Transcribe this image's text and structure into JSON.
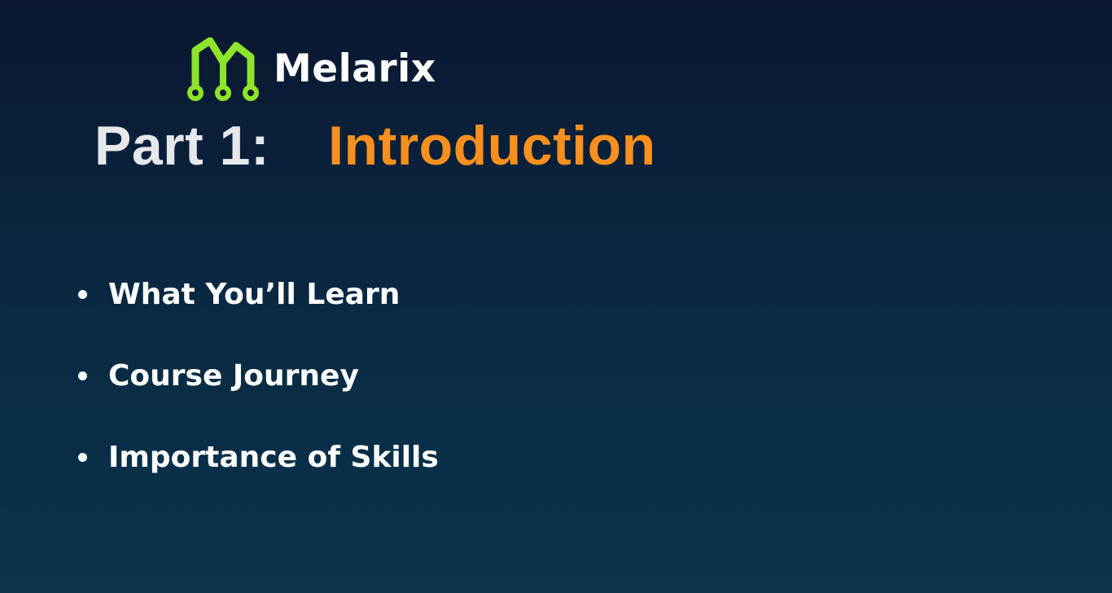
{
  "brand": {
    "name": "Melarix",
    "accent_color": "#8ee42a"
  },
  "title": {
    "prefix": "Part 1:",
    "main": "Introduction",
    "prefix_color": "#e6e7ea",
    "main_color": "#f7901e"
  },
  "bullets": [
    "What You’ll Learn",
    "Course Journey",
    "Importance of Skills"
  ],
  "icons": {
    "logo": "melarix-logo-mark-icon",
    "bullet": "bullet-dot-icon"
  }
}
